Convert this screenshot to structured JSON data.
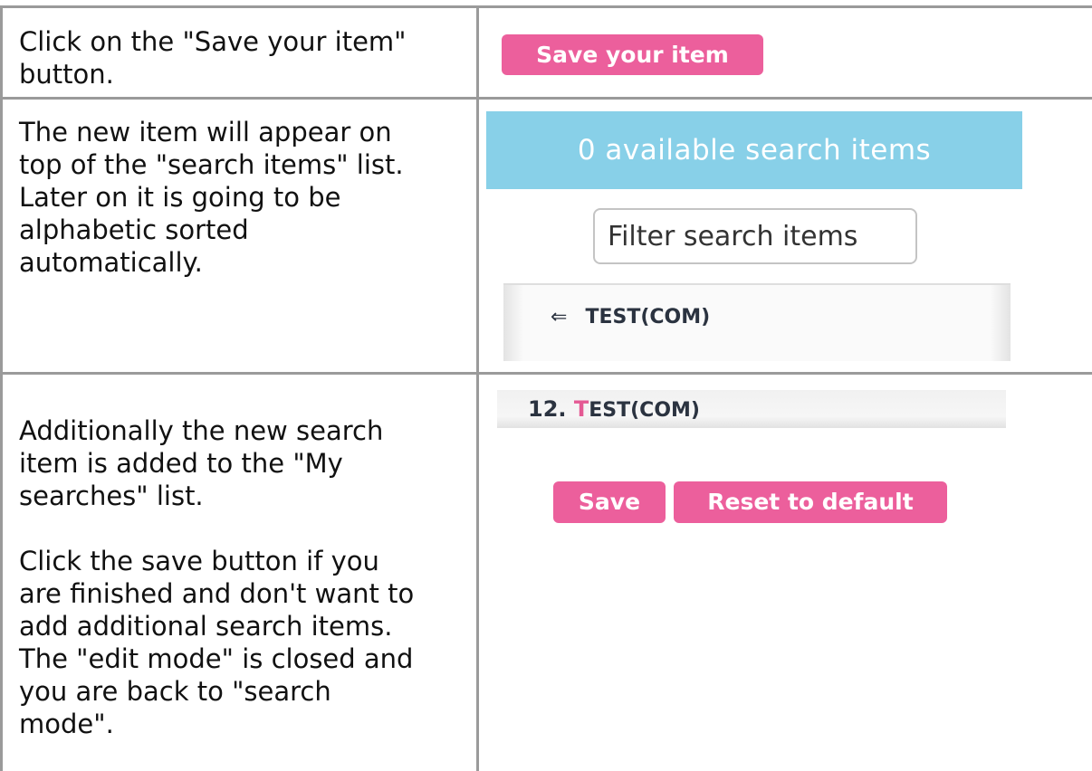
{
  "rows": [
    {
      "instruction_lines": [
        "Click on the \"Save your item\"",
        "button."
      ],
      "save_item_label": "Save your item"
    },
    {
      "instruction_lines": [
        "The new item will appear on",
        "top of the \"search items\" list.",
        "Later on it is going to be",
        "alphabetic sorted",
        "automatically."
      ],
      "banner_text": "0 available search items",
      "filter_placeholder": "Filter search items",
      "list_items": [
        {
          "arrow": "⇐",
          "label": "TEST(COM)"
        }
      ]
    },
    {
      "instruction_lines_a": [
        "Additionally the new search",
        "item is added to the \"My",
        "searches\" list."
      ],
      "instruction_lines_b": [
        "Click the save button if you",
        "are finished and don't want to",
        "add additional search items.",
        "The \"edit mode\" is closed and",
        "you are back to \"search",
        "mode\"."
      ],
      "my_search_item": {
        "number": "12.",
        "first_letter": "T",
        "rest": "EST(COM)"
      },
      "save_label": "Save",
      "reset_label": "Reset to default"
    }
  ],
  "colors": {
    "button_pink": "#ec5f9c",
    "banner_blue": "#88d0e8",
    "grid_line": "#9a9a9a"
  }
}
